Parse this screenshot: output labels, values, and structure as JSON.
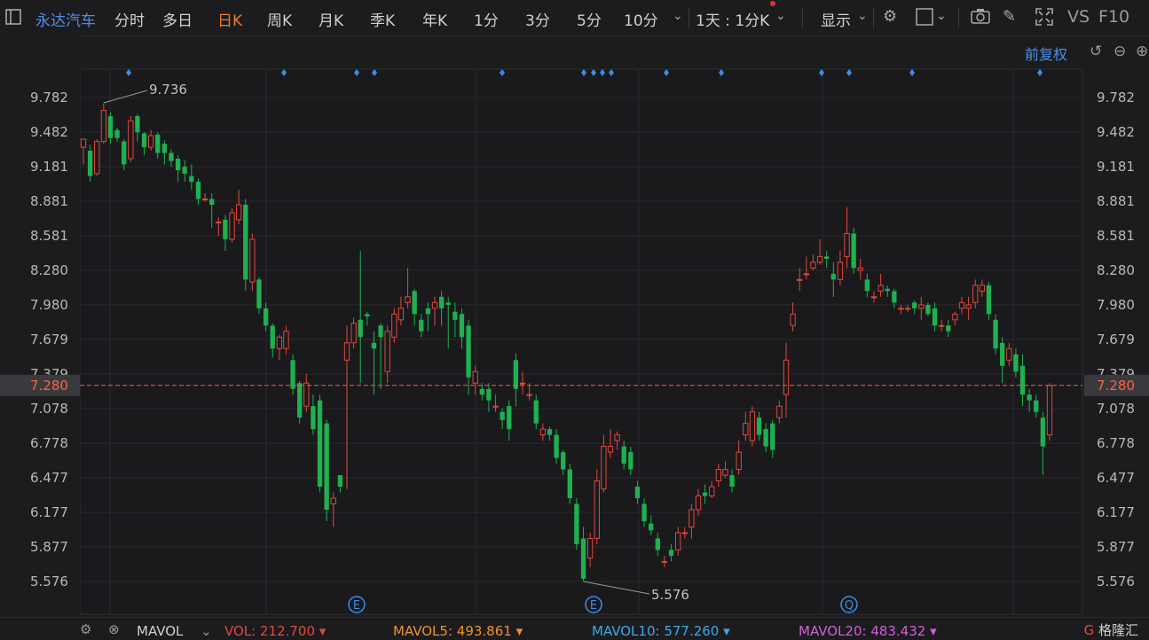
{
  "toolbar": {
    "stock_name": "永达汽车",
    "periods": [
      "分时",
      "多日",
      "日K",
      "周K",
      "月K",
      "季K",
      "年K",
      "1分",
      "3分",
      "5分",
      "10分"
    ],
    "active_period": "日K",
    "combo": "1天 : 1分K",
    "display": "显示",
    "vs": "VS",
    "f10": "F10"
  },
  "adjust": "前复权",
  "chart_data": {
    "type": "candlestick",
    "y_ticks": [
      9.782,
      9.482,
      9.181,
      8.881,
      8.581,
      8.28,
      7.98,
      7.679,
      7.379,
      7.078,
      6.778,
      6.477,
      6.177,
      5.877,
      5.576
    ],
    "y_tick_labels": [
      "9.782",
      "9.482",
      "9.181",
      "8.881",
      "8.581",
      "8.280",
      "7.980",
      "7.679",
      "7.379",
      "7.078",
      "6.778",
      "6.477",
      "6.177",
      "5.877",
      "5.576"
    ],
    "current_price": 7.28,
    "current_price_label": "7.280",
    "high_marker": {
      "value": 9.736,
      "label": "9.736"
    },
    "low_marker": {
      "value": 5.576,
      "label": "5.576"
    },
    "candles": [
      [
        9.35,
        9.42,
        9.2,
        9.4
      ],
      [
        9.32,
        9.1,
        9.05,
        9.37
      ],
      [
        9.12,
        9.4,
        9.1,
        9.42
      ],
      [
        9.4,
        9.67,
        9.38,
        9.73
      ],
      [
        9.62,
        9.43,
        9.38,
        9.65
      ],
      [
        9.5,
        9.43,
        9.4,
        9.52
      ],
      [
        9.4,
        9.2,
        9.15,
        9.42
      ],
      [
        9.25,
        9.58,
        9.22,
        9.62
      ],
      [
        9.62,
        9.48,
        9.4,
        9.64
      ],
      [
        9.47,
        9.35,
        9.28,
        9.48
      ],
      [
        9.35,
        9.45,
        9.32,
        9.5
      ],
      [
        9.46,
        9.3,
        9.25,
        9.48
      ],
      [
        9.38,
        9.3,
        9.2,
        9.41
      ],
      [
        9.3,
        9.23,
        9.18,
        9.33
      ],
      [
        9.25,
        9.15,
        9.05,
        9.28
      ],
      [
        9.18,
        9.12,
        9.05,
        9.24
      ],
      [
        9.1,
        9.05,
        8.98,
        9.2
      ],
      [
        9.05,
        8.9,
        8.85,
        9.08
      ],
      [
        8.9,
        8.9,
        8.88,
        8.95
      ],
      [
        8.9,
        8.85,
        8.65,
        8.95
      ],
      [
        8.7,
        8.7,
        8.58,
        8.74
      ],
      [
        8.72,
        8.55,
        8.45,
        8.76
      ],
      [
        8.55,
        8.78,
        8.52,
        8.82
      ],
      [
        8.72,
        8.85,
        8.68,
        8.98
      ],
      [
        8.85,
        8.2,
        8.1,
        8.9
      ],
      [
        8.18,
        8.55,
        8.1,
        8.6
      ],
      [
        8.2,
        7.95,
        7.9,
        8.22
      ],
      [
        7.95,
        7.8,
        7.75,
        8.0
      ],
      [
        7.8,
        7.6,
        7.52,
        7.82
      ],
      [
        7.6,
        7.7,
        7.5,
        7.72
      ],
      [
        7.6,
        7.75,
        7.55,
        7.8
      ],
      [
        7.5,
        7.25,
        7.2,
        7.55
      ],
      [
        7.3,
        7.0,
        6.95,
        7.32
      ],
      [
        7.1,
        7.3,
        7.05,
        7.38
      ],
      [
        7.1,
        6.9,
        6.85,
        7.2
      ],
      [
        7.15,
        6.4,
        6.35,
        7.2
      ],
      [
        6.95,
        6.2,
        6.1,
        6.98
      ],
      [
        6.25,
        6.3,
        6.05,
        6.35
      ],
      [
        6.5,
        6.4,
        6.35,
        6.5
      ],
      [
        7.5,
        7.65,
        6.38,
        7.8
      ],
      [
        7.65,
        7.82,
        7.6,
        7.87
      ],
      [
        7.85,
        7.7,
        7.3,
        8.45
      ],
      [
        7.9,
        7.88,
        7.8,
        7.92
      ],
      [
        7.65,
        7.6,
        7.2,
        7.75
      ],
      [
        7.8,
        7.7,
        7.25,
        7.82
      ],
      [
        7.4,
        7.75,
        7.3,
        7.8
      ],
      [
        7.7,
        7.9,
        7.65,
        7.95
      ],
      [
        7.85,
        7.95,
        7.8,
        8.05
      ],
      [
        8.0,
        8.05,
        7.95,
        8.3
      ],
      [
        8.1,
        7.9,
        7.8,
        8.12
      ],
      [
        7.85,
        7.75,
        7.7,
        7.9
      ],
      [
        7.95,
        7.9,
        7.75,
        8.0
      ],
      [
        7.95,
        8.0,
        7.8,
        8.05
      ],
      [
        8.05,
        7.95,
        7.8,
        8.1
      ],
      [
        8.0,
        7.98,
        7.6,
        8.05
      ],
      [
        7.92,
        7.85,
        7.7,
        8.0
      ],
      [
        7.9,
        7.7,
        7.6,
        7.95
      ],
      [
        7.8,
        7.35,
        7.2,
        7.85
      ],
      [
        7.3,
        7.4,
        7.2,
        7.45
      ],
      [
        7.25,
        7.2,
        7.15,
        7.3
      ],
      [
        7.25,
        7.15,
        7.05,
        7.3
      ],
      [
        7.1,
        7.1,
        7.05,
        7.2
      ],
      [
        7.05,
        6.98,
        6.9,
        7.08
      ],
      [
        7.1,
        6.9,
        6.8,
        7.15
      ],
      [
        7.5,
        7.25,
        7.1,
        7.56
      ],
      [
        7.3,
        7.3,
        7.2,
        7.4
      ],
      [
        7.2,
        7.2,
        7.15,
        7.3
      ],
      [
        7.15,
        6.95,
        6.9,
        7.2
      ],
      [
        6.85,
        6.9,
        6.8,
        6.95
      ],
      [
        6.9,
        6.85,
        6.8,
        6.92
      ],
      [
        6.85,
        6.65,
        6.6,
        6.9
      ],
      [
        6.7,
        6.55,
        6.5,
        6.72
      ],
      [
        6.55,
        6.3,
        6.25,
        6.6
      ],
      [
        6.25,
        5.9,
        5.85,
        6.3
      ],
      [
        5.95,
        5.6,
        5.58,
        6.05
      ],
      [
        5.78,
        5.95,
        5.7,
        6.0
      ],
      [
        5.95,
        6.45,
        5.9,
        6.55
      ],
      [
        6.38,
        6.75,
        6.35,
        6.85
      ],
      [
        6.7,
        6.75,
        6.65,
        6.9
      ],
      [
        6.8,
        6.85,
        6.72,
        6.88
      ],
      [
        6.75,
        6.6,
        6.55,
        6.8
      ],
      [
        6.7,
        6.55,
        6.5,
        6.75
      ],
      [
        6.4,
        6.3,
        6.25,
        6.45
      ],
      [
        6.25,
        6.1,
        6.05,
        6.3
      ],
      [
        6.08,
        6.02,
        5.98,
        6.15
      ],
      [
        5.95,
        5.85,
        5.8,
        6.0
      ],
      [
        5.75,
        5.75,
        5.7,
        5.8
      ],
      [
        5.85,
        5.8,
        5.75,
        5.9
      ],
      [
        5.85,
        6.0,
        5.8,
        6.05
      ],
      [
        6.0,
        6.0,
        5.95,
        6.05
      ],
      [
        6.05,
        6.2,
        5.95,
        6.25
      ],
      [
        6.2,
        6.32,
        6.15,
        6.38
      ],
      [
        6.35,
        6.32,
        6.25,
        6.42
      ],
      [
        6.32,
        6.4,
        6.3,
        6.45
      ],
      [
        6.45,
        6.55,
        6.4,
        6.6
      ],
      [
        6.5,
        6.55,
        6.48,
        6.62
      ],
      [
        6.5,
        6.4,
        6.35,
        6.55
      ],
      [
        6.55,
        6.7,
        6.5,
        6.8
      ],
      [
        6.85,
        6.95,
        6.8,
        7.05
      ],
      [
        6.8,
        7.05,
        6.75,
        7.1
      ],
      [
        7.0,
        6.85,
        6.8,
        7.05
      ],
      [
        6.9,
        6.75,
        6.7,
        6.95
      ],
      [
        6.95,
        6.72,
        6.65,
        6.98
      ],
      [
        7.0,
        7.1,
        6.95,
        7.15
      ],
      [
        7.2,
        7.5,
        7.0,
        7.65
      ],
      [
        7.8,
        7.9,
        7.75,
        8.0
      ],
      [
        8.2,
        8.2,
        8.1,
        8.3
      ],
      [
        8.25,
        8.25,
        8.2,
        8.4
      ],
      [
        8.3,
        8.35,
        8.28,
        8.42
      ],
      [
        8.35,
        8.4,
        8.33,
        8.55
      ],
      [
        8.4,
        8.38,
        8.3,
        8.45
      ],
      [
        8.25,
        8.2,
        8.05,
        8.35
      ],
      [
        8.2,
        8.35,
        8.15,
        8.45
      ],
      [
        8.4,
        8.6,
        8.3,
        8.83
      ],
      [
        8.6,
        8.3,
        8.25,
        8.65
      ],
      [
        8.28,
        8.3,
        8.2,
        8.38
      ],
      [
        8.2,
        8.1,
        8.05,
        8.25
      ],
      [
        8.05,
        8.05,
        8.0,
        8.1
      ],
      [
        8.1,
        8.15,
        8.05,
        8.25
      ],
      [
        8.12,
        8.1,
        8.05,
        8.15
      ],
      [
        8.1,
        8.0,
        7.95,
        8.12
      ],
      [
        7.95,
        7.95,
        7.9,
        7.98
      ],
      [
        7.95,
        7.95,
        7.92,
        7.98
      ],
      [
        8.0,
        7.95,
        7.9,
        8.02
      ],
      [
        7.95,
        7.98,
        7.85,
        8.05
      ],
      [
        7.98,
        7.9,
        7.88,
        8.0
      ],
      [
        7.95,
        7.8,
        7.75,
        8.0
      ],
      [
        7.8,
        7.8,
        7.75,
        7.85
      ],
      [
        7.8,
        7.75,
        7.7,
        7.85
      ],
      [
        7.85,
        7.9,
        7.8,
        7.92
      ],
      [
        7.95,
        8.0,
        7.9,
        8.05
      ],
      [
        7.95,
        7.98,
        7.85,
        8.05
      ],
      [
        8.0,
        8.15,
        7.95,
        8.2
      ],
      [
        8.1,
        8.15,
        8.05,
        8.2
      ],
      [
        8.15,
        7.9,
        7.85,
        8.18
      ],
      [
        7.85,
        7.6,
        7.55,
        7.9
      ],
      [
        7.65,
        7.45,
        7.3,
        7.7
      ],
      [
        7.5,
        7.6,
        7.45,
        7.65
      ],
      [
        7.55,
        7.4,
        7.35,
        7.6
      ],
      [
        7.45,
        7.2,
        7.1,
        7.55
      ],
      [
        7.2,
        7.15,
        7.05,
        7.25
      ],
      [
        7.15,
        7.05,
        7.0,
        7.2
      ],
      [
        7.0,
        6.75,
        6.5,
        7.05
      ],
      [
        6.85,
        7.28,
        6.8,
        7.3
      ]
    ],
    "event_labels": [
      "E",
      "E",
      "Q"
    ],
    "indicator": "MAVOL",
    "vol_legend": [
      {
        "label": "VOL:",
        "value": "212.700",
        "color": "#e04a3a"
      },
      {
        "label": "MAVOL5:",
        "value": "493.861",
        "color": "#f0902a"
      },
      {
        "label": "MAVOL10:",
        "value": "577.260",
        "color": "#3fa8e8"
      },
      {
        "label": "MAVOL20:",
        "value": "483.432",
        "color": "#d060d8"
      }
    ],
    "colors": {
      "up": "#e2473a",
      "down": "#1fb050",
      "grid": "#2a2a2e",
      "dash": "#e8604a",
      "marker": "#3a8ee8"
    }
  },
  "brand": "格隆汇"
}
